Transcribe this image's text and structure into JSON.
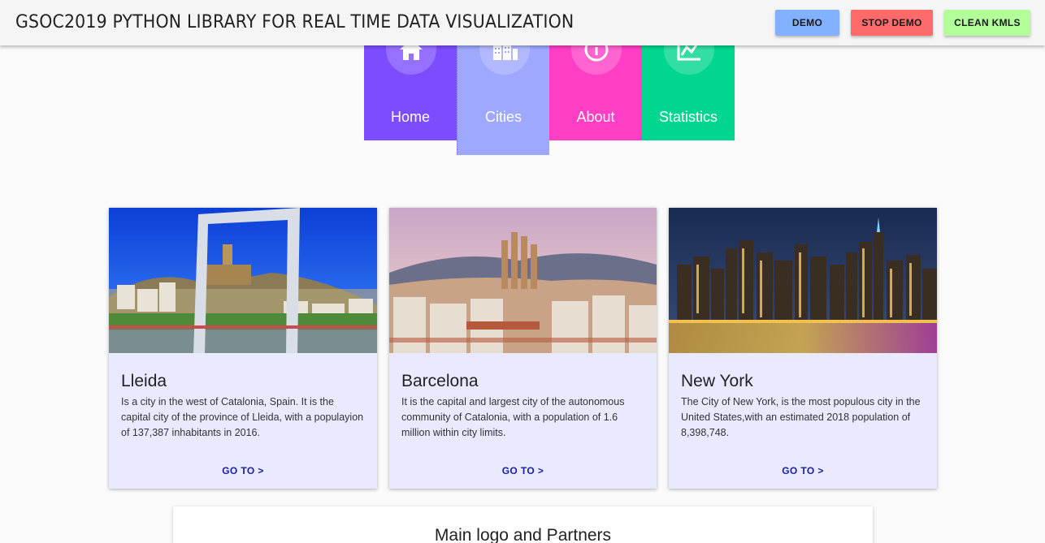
{
  "header": {
    "title_bold": "GSOC2019",
    "title_rest": " PYTHON LIBRARY FOR REAL TIME DATA VISUALIZATION",
    "buttons": {
      "demo": "DEMO",
      "stop_demo": "STOP DEMO",
      "clean_kmls": "CLEAN KMLS"
    },
    "colors": {
      "demo": "#82b1ff",
      "stop_demo": "#ff6b6b",
      "clean_kmls": "#b2ff99"
    }
  },
  "nav_tiles": [
    {
      "label": "Home",
      "icon": "home-icon",
      "color": "#7c4dff"
    },
    {
      "label": "Cities",
      "icon": "city-icon",
      "color": "#9fa8ff",
      "active": true
    },
    {
      "label": "About",
      "icon": "info-icon",
      "color": "#ff3ec6"
    },
    {
      "label": "Statistics",
      "icon": "chart-icon",
      "color": "#00d68f"
    }
  ],
  "cards": [
    {
      "title": "Lleida",
      "description": "Is a city in the west of Catalonia, Spain. It is the capital city of the province of Lleida, with a populayion of 137,387 inhabitants in 2016.",
      "link": "GO TO >"
    },
    {
      "title": "Barcelona",
      "description": "It is the capital and largest city of the autonomous community of Catalonia, with a population of 1.6 million within city limits.",
      "link": "GO TO >"
    },
    {
      "title": "New York",
      "description": "The City of New York, is the most populous city in the United States,with an estimated 2018 population of 8,398,748.",
      "link": "GO TO >"
    }
  ],
  "partners": {
    "title": "Main logo and Partners"
  }
}
